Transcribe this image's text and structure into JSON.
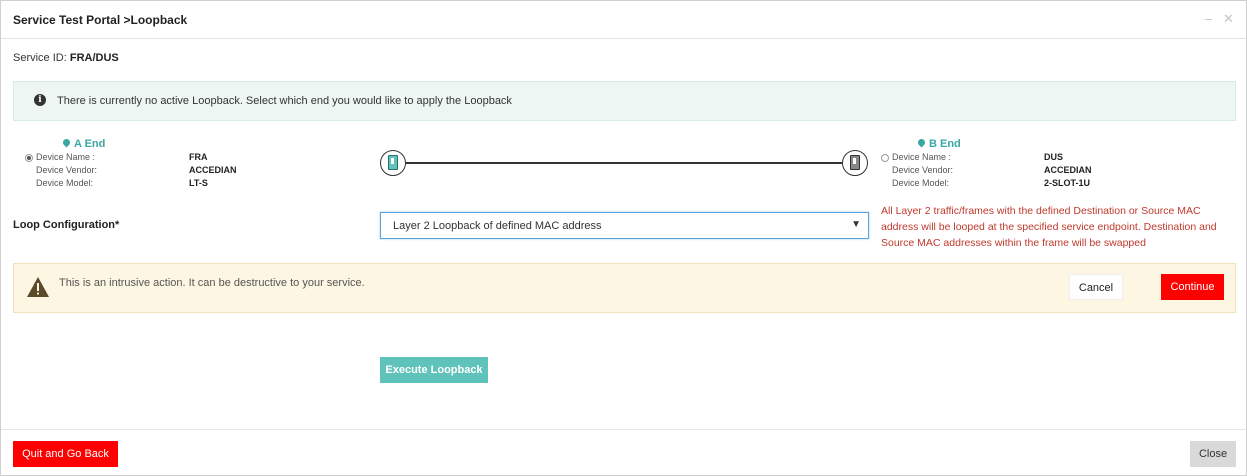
{
  "window": {
    "title": "Service Test Portal >Loopback",
    "minimize_glyph": "‒",
    "close_glyph": "✕"
  },
  "service": {
    "label": "Service ID:",
    "value": "FRA/DUS"
  },
  "info": {
    "icon": "info-icon",
    "text": "There is currently no active Loopback. Select which end you would like to apply the Loopback"
  },
  "a_end": {
    "title": "A End",
    "selected": true,
    "name_label": "Device Name :",
    "name": "FRA",
    "vendor_label": "Device Vendor:",
    "vendor": "ACCEDIAN",
    "model_label": "Device Model:",
    "model": "LT-S"
  },
  "b_end": {
    "title": "B End",
    "selected": false,
    "name_label": "Device Name :",
    "name": "DUS",
    "vendor_label": "Device Vendor:",
    "vendor": "ACCEDIAN",
    "model_label": "Device Model:",
    "model": "2-SLOT-1U"
  },
  "loop": {
    "label": "Loop Configuration*",
    "selected_option": "Layer 2 Loopback of defined MAC address",
    "description": "All Layer 2 traffic/frames with the defined Destination or Source MAC address will be looped at the specified service endpoint. Destination and Source MAC addresses within the frame will be swapped"
  },
  "warning": {
    "icon": "warning-icon",
    "text": "This is an intrusive action. It can be destructive to your service."
  },
  "buttons": {
    "cancel": "Cancel",
    "continue": "Continue",
    "execute": "Execute Loopback",
    "quit": "Quit and Go Back",
    "close": "Close"
  },
  "colors": {
    "accent": "#5fc2bb",
    "danger": "#ff0000",
    "info_bg": "#eef6f3",
    "warn_bg": "#fdf6e3",
    "desc_text": "#c0392b"
  }
}
